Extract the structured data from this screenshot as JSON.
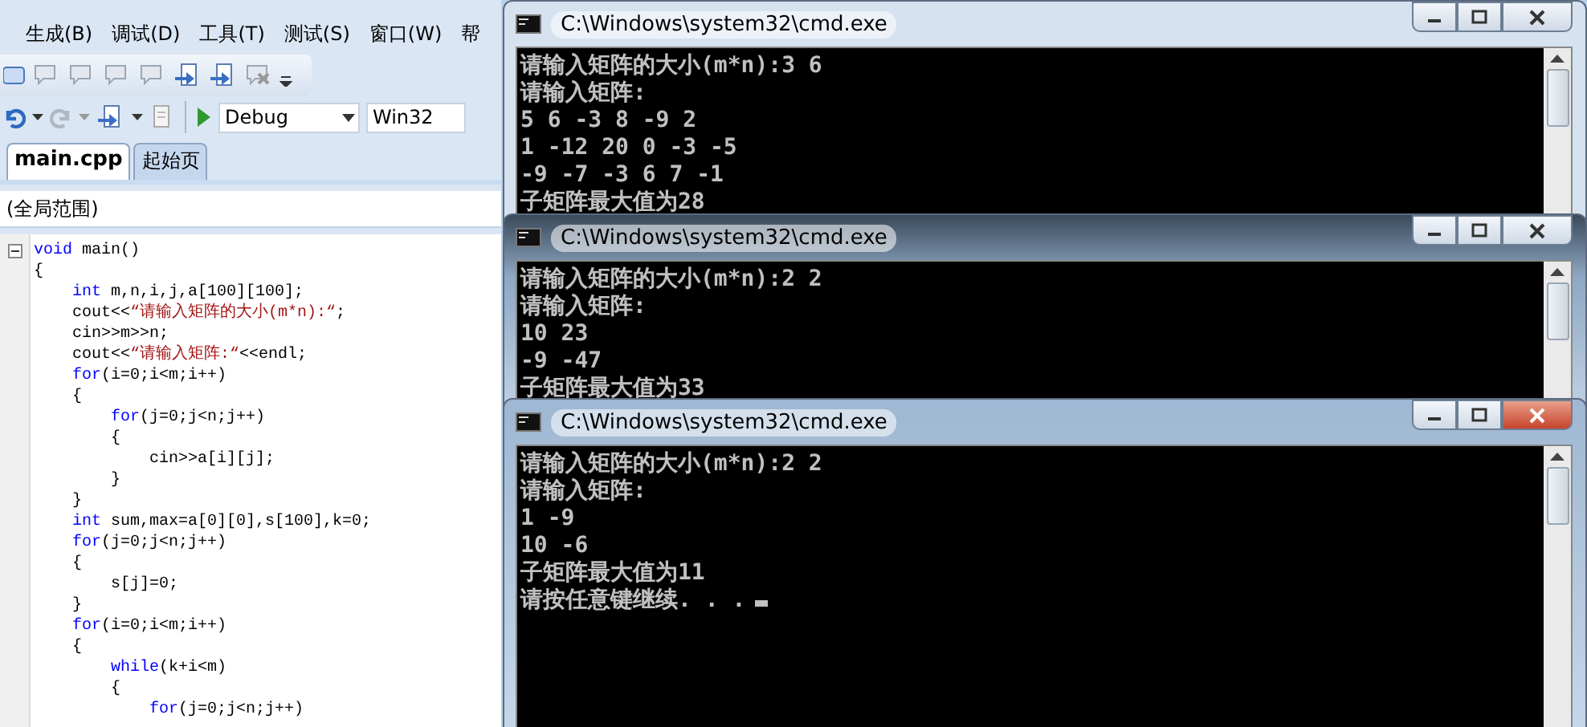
{
  "ide": {
    "menu": [
      "生成(B)",
      "调试(D)",
      "工具(T)",
      "测试(S)",
      "窗口(W)",
      "帮"
    ],
    "toolbar": {
      "configuration": "Debug",
      "platform": "Win32"
    },
    "tabs": [
      {
        "label": "main.cpp",
        "selected": true
      },
      {
        "label": "起始页",
        "selected": false
      }
    ],
    "scope": "(全局范围)",
    "code": [
      [
        {
          "kind": "keyword",
          "text": "void"
        },
        {
          "kind": "plain",
          "text": " main()"
        }
      ],
      [
        {
          "kind": "plain",
          "text": "{"
        }
      ],
      [
        {
          "kind": "keyword",
          "text": "    int"
        },
        {
          "kind": "plain",
          "text": " m,n,i,j,a[100][100];"
        }
      ],
      [
        {
          "kind": "plain",
          "text": "    cout<<"
        },
        {
          "kind": "string",
          "text": "“请输入矩阵的大小(m*n):“"
        },
        {
          "kind": "plain",
          "text": ";"
        }
      ],
      [
        {
          "kind": "plain",
          "text": "    cin>>m>>n;"
        }
      ],
      [
        {
          "kind": "plain",
          "text": "    cout<<"
        },
        {
          "kind": "string",
          "text": "“请输入矩阵:“"
        },
        {
          "kind": "plain",
          "text": "<<endl;"
        }
      ],
      [
        {
          "kind": "keyword",
          "text": "    for"
        },
        {
          "kind": "plain",
          "text": "(i=0;i<m;i++)"
        }
      ],
      [
        {
          "kind": "plain",
          "text": "    {"
        }
      ],
      [
        {
          "kind": "keyword",
          "text": "        for"
        },
        {
          "kind": "plain",
          "text": "(j=0;j<n;j++)"
        }
      ],
      [
        {
          "kind": "plain",
          "text": "        {"
        }
      ],
      [
        {
          "kind": "plain",
          "text": "            cin>>a[i][j];"
        }
      ],
      [
        {
          "kind": "plain",
          "text": "        }"
        }
      ],
      [
        {
          "kind": "plain",
          "text": "    }"
        }
      ],
      [
        {
          "kind": "keyword",
          "text": "    int"
        },
        {
          "kind": "plain",
          "text": " sum,max=a[0][0],s[100],k=0;"
        }
      ],
      [
        {
          "kind": "keyword",
          "text": "    for"
        },
        {
          "kind": "plain",
          "text": "(j=0;j<n;j++)"
        }
      ],
      [
        {
          "kind": "plain",
          "text": "    {"
        }
      ],
      [
        {
          "kind": "plain",
          "text": "        s[j]=0;"
        }
      ],
      [
        {
          "kind": "plain",
          "text": "    }"
        }
      ],
      [
        {
          "kind": "keyword",
          "text": "    for"
        },
        {
          "kind": "plain",
          "text": "(i=0;i<m;i++)"
        }
      ],
      [
        {
          "kind": "plain",
          "text": "    {"
        }
      ],
      [
        {
          "kind": "keyword",
          "text": "        while"
        },
        {
          "kind": "plain",
          "text": "(k+i<m)"
        }
      ],
      [
        {
          "kind": "plain",
          "text": "        {"
        }
      ],
      [
        {
          "kind": "keyword",
          "text": "            for"
        },
        {
          "kind": "plain",
          "text": "(j=0;j<n;j++)"
        }
      ]
    ]
  },
  "consoles": [
    {
      "title": "C:\\Windows\\system32\\cmd.exe",
      "active": false,
      "cursor": false,
      "lines": [
        "请输入矩阵的大小(m*n):3 6",
        "请输入矩阵:",
        "5 6 -3 8 -9 2",
        "1 -12 20 0 -3 -5",
        "-9 -7 -3 6 7 -1",
        "子矩阵最大值为28"
      ]
    },
    {
      "title": "C:\\Windows\\system32\\cmd.exe",
      "active": false,
      "cursor": false,
      "lines": [
        "请输入矩阵的大小(m*n):2 2",
        "请输入矩阵:",
        "10 23",
        "-9 -47",
        "子矩阵最大值为33"
      ]
    },
    {
      "title": "C:\\Windows\\system32\\cmd.exe",
      "active": true,
      "cursor": true,
      "lines": [
        "请输入矩阵的大小(m*n):2 2",
        "请输入矩阵:",
        "1 -9",
        "10 -6",
        "子矩阵最大值为11",
        "请按任意键继续. . ."
      ]
    }
  ]
}
